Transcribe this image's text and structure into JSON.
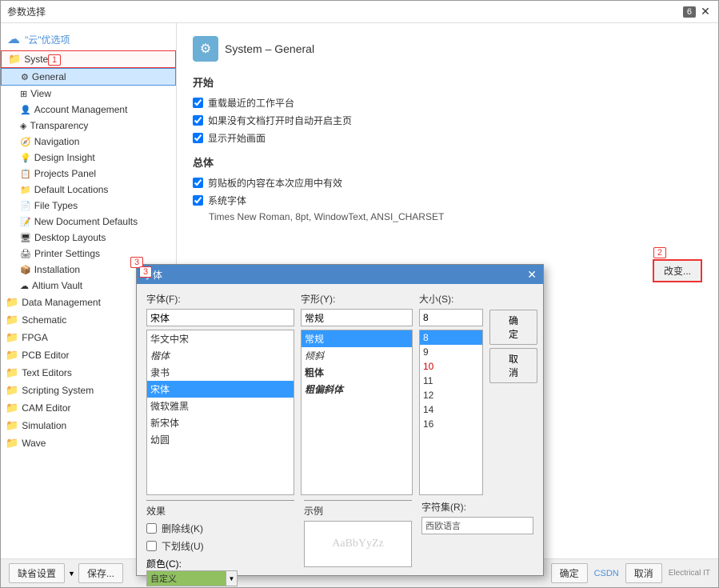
{
  "window": {
    "title": "参数选择",
    "badge": "6",
    "close_btn": "✕"
  },
  "cloud_label": "\"云\"优选项",
  "numbers": {
    "n1": "1",
    "n2": "2",
    "n3": "3"
  },
  "sidebar": {
    "items": [
      {
        "id": "system",
        "label": "System",
        "level": 1,
        "type": "folder",
        "expanded": true
      },
      {
        "id": "general",
        "label": "General",
        "level": 2,
        "type": "item",
        "selected": true
      },
      {
        "id": "view",
        "label": "View",
        "level": 2,
        "type": "item"
      },
      {
        "id": "account",
        "label": "Account Management",
        "level": 2,
        "type": "item"
      },
      {
        "id": "transparency",
        "label": "Transparency",
        "level": 2,
        "type": "item"
      },
      {
        "id": "navigation",
        "label": "Navigation",
        "level": 2,
        "type": "item"
      },
      {
        "id": "design",
        "label": "Design Insight",
        "level": 2,
        "type": "item"
      },
      {
        "id": "projects",
        "label": "Projects Panel",
        "level": 2,
        "type": "item"
      },
      {
        "id": "locations",
        "label": "Default Locations",
        "level": 2,
        "type": "item"
      },
      {
        "id": "filetypes",
        "label": "File Types",
        "level": 2,
        "type": "item"
      },
      {
        "id": "newdoc",
        "label": "New Document Defaults",
        "level": 2,
        "type": "item"
      },
      {
        "id": "desktop",
        "label": "Desktop Layouts",
        "level": 2,
        "type": "item"
      },
      {
        "id": "printer",
        "label": "Printer Settings",
        "level": 2,
        "type": "item"
      },
      {
        "id": "install",
        "label": "Installation",
        "level": 2,
        "type": "item"
      },
      {
        "id": "altium",
        "label": "Altium Vault",
        "level": 2,
        "type": "item"
      },
      {
        "id": "datamgmt",
        "label": "Data Management",
        "level": 1,
        "type": "folder"
      },
      {
        "id": "schematic",
        "label": "Schematic",
        "level": 1,
        "type": "folder"
      },
      {
        "id": "fpga",
        "label": "FPGA",
        "level": 1,
        "type": "folder"
      },
      {
        "id": "pcb",
        "label": "PCB Editor",
        "level": 1,
        "type": "folder"
      },
      {
        "id": "text",
        "label": "Text Editors",
        "level": 1,
        "type": "folder"
      },
      {
        "id": "scripting",
        "label": "Scripting System",
        "level": 1,
        "type": "folder"
      },
      {
        "id": "cam",
        "label": "CAM Editor",
        "level": 1,
        "type": "folder"
      },
      {
        "id": "simulation",
        "label": "Simulation",
        "level": 1,
        "type": "folder"
      },
      {
        "id": "wave",
        "label": "Wave",
        "level": 1,
        "type": "folder"
      }
    ]
  },
  "main": {
    "section_title": "System – General",
    "group1": "开始",
    "check1": "重载最近的工作平台",
    "check2": "如果没有文档打开时自动开启主页",
    "check3": "显示开始画面",
    "group2": "总体",
    "check4": "剪贴板的内容在本次应用中有效",
    "check5": "系统字体",
    "font_preview": "Times New Roman, 8pt, WindowText, ANSI_CHARSET",
    "change_btn": "改变..."
  },
  "font_dialog": {
    "title": "字体",
    "font_label": "字体(F):",
    "style_label": "字形(Y):",
    "size_label": "大小(S):",
    "font_input": "宋体",
    "style_input": "常规",
    "size_input": "8",
    "font_list": [
      {
        "label": "华文中宋",
        "style": "chinese"
      },
      {
        "label": "楷体",
        "style": "italic"
      },
      {
        "label": "隶书",
        "style": "chinese"
      },
      {
        "label": "宋体",
        "style": "selected"
      },
      {
        "label": "微软雅黑",
        "style": "normal"
      },
      {
        "label": "新宋体",
        "style": "normal"
      },
      {
        "label": "幼圆",
        "style": "normal"
      }
    ],
    "style_list": [
      {
        "label": "常规",
        "style": "selected"
      },
      {
        "label": "倾斜",
        "style": "italic"
      },
      {
        "label": "粗体",
        "style": "bold"
      },
      {
        "label": "粗偏斜体",
        "style": "bold-italic"
      }
    ],
    "size_list": [
      {
        "label": "8",
        "style": "selected"
      },
      {
        "label": "9",
        "style": "normal"
      },
      {
        "label": "10",
        "style": "red"
      },
      {
        "label": "11",
        "style": "normal"
      },
      {
        "label": "12",
        "style": "normal"
      },
      {
        "label": "14",
        "style": "normal"
      },
      {
        "label": "16",
        "style": "normal"
      }
    ],
    "ok_btn": "确定",
    "cancel_btn": "取消",
    "effects_title": "效果",
    "check_strikeout": "删除线(K)",
    "check_underline": "下划线(U)",
    "color_label": "颜色(C):",
    "color_value": "自定义",
    "sample_title": "示例",
    "sample_text": "AaBbYyZz",
    "charset_label": "字符集(R):",
    "charset_value": "西欧语言"
  },
  "bottom": {
    "defaults_btn": "缺省设置",
    "save_btn": "保存...",
    "ok_btn": "确定",
    "cancel_btn": "取消",
    "brand_text": "CSDN",
    "brand_sub": "Electrical IT"
  }
}
